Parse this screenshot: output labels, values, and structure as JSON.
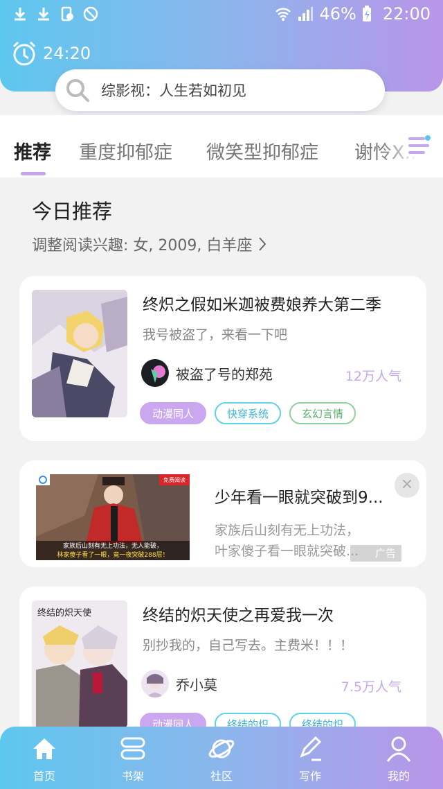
{
  "status_bar": {
    "battery": "46%",
    "time": "22:00"
  },
  "timer": {
    "value": "24:20"
  },
  "search": {
    "placeholder": "综影视：人生若如初见"
  },
  "tabs": [
    {
      "label": "推荐",
      "active": true
    },
    {
      "label": "重度抑郁症",
      "active": false
    },
    {
      "label": "微笑型抑郁症",
      "active": false
    },
    {
      "label": "谢怜X..",
      "active": false
    }
  ],
  "recommend": {
    "title": "今日推荐",
    "subtitle": "调整阅读兴趣: 女, 2009, 白羊座"
  },
  "books": [
    {
      "title": "终炽之假如米迦被费娘养大第二季",
      "desc": "我号被盗了，来看一下吧",
      "author": "被盗了号的郑苑",
      "popularity": "12万人气",
      "tags": [
        "动漫同人",
        "快穿系统",
        "玄幻言情"
      ]
    },
    {
      "title": "终结的炽天使之再爱我一次",
      "desc": "别抄我的，自己写去。主费米！！！",
      "author": "乔小莫",
      "popularity": "7.5万人气",
      "tags": [
        "动漫同人",
        "终结的炽",
        "终结的炽"
      ],
      "cover_text": "终结的炽天使"
    }
  ],
  "ad": {
    "title": "少年看一眼就突破到9...",
    "desc_line1": "家族后山刻有无上功法，",
    "desc_line2": "叶家傻子看一眼就突破...",
    "label": "广告",
    "close": "×",
    "image_badge": "免费阅读",
    "image_caption_1": "家族后山刻有无上功法，无人能破，",
    "image_caption_2": "林家傻子看了一眼，竟一夜突破288层！"
  },
  "bottom_nav": [
    {
      "label": "首页",
      "icon": "home-icon"
    },
    {
      "label": "书架",
      "icon": "bookshelf-icon"
    },
    {
      "label": "社区",
      "icon": "planet-icon"
    },
    {
      "label": "写作",
      "icon": "pen-icon"
    },
    {
      "label": "我的",
      "icon": "user-icon"
    }
  ],
  "colors": {
    "gradient_start": "#5ec7ee",
    "gradient_end": "#b995e8",
    "accent_purple": "#c6a8ef",
    "tag_teal": "#5fd1e8",
    "tag_green": "#8fd19e"
  }
}
